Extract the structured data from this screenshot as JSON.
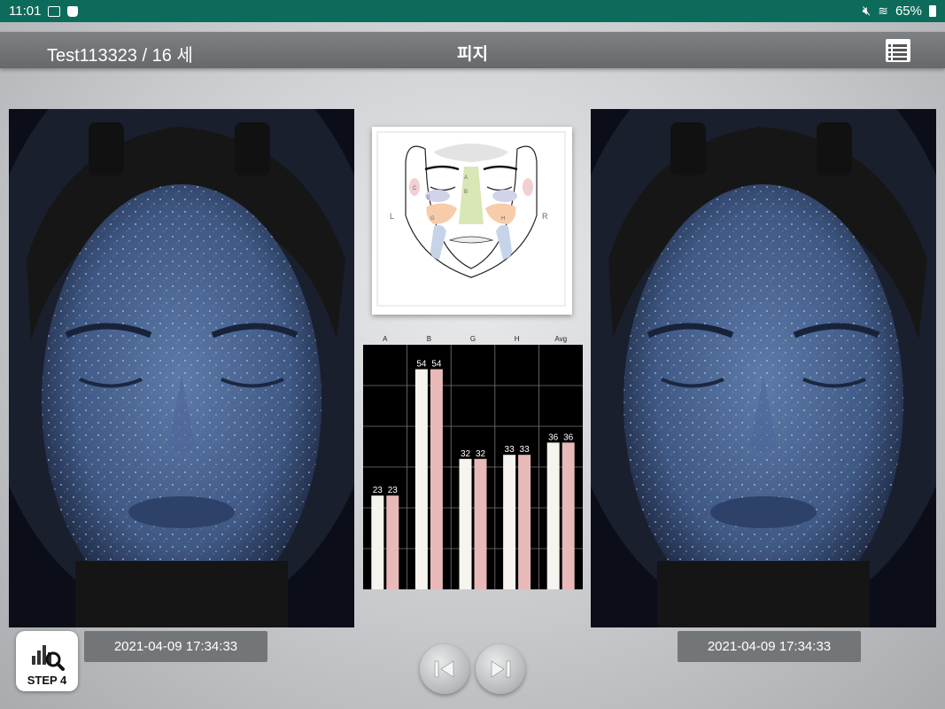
{
  "status_bar": {
    "time": "11:01",
    "battery_text": "65%",
    "icons": [
      "image-icon",
      "bag-icon",
      "mute-icon",
      "wifi-icon",
      "battery-icon"
    ]
  },
  "header": {
    "patient": "Test113323 / 16 세",
    "title": "피지",
    "menu_icon": "list-menu-icon"
  },
  "diagram": {
    "left_label": "L",
    "right_label": "R",
    "zone_labels": [
      "A",
      "B",
      "C",
      "E",
      "G",
      "H"
    ]
  },
  "chart_data": {
    "type": "bar",
    "categories": [
      "A",
      "B",
      "G",
      "H",
      "Avg"
    ],
    "series": [
      {
        "values": [
          23,
          54,
          32,
          33,
          36
        ],
        "color": "#f7f3ee"
      },
      {
        "values": [
          23,
          54,
          32,
          33,
          36
        ],
        "color": "#e8b9b9"
      }
    ],
    "ylim": [
      0,
      60
    ],
    "grid": true,
    "background": "#000000"
  },
  "left_panel": {
    "timestamp": "2021-04-09 17:34:33"
  },
  "right_panel": {
    "timestamp": "2021-04-09 17:34:33"
  },
  "step_button": {
    "label": "STEP 4",
    "icon": "chart-magnifier-icon"
  },
  "nav": {
    "prev_icon": "previous-icon",
    "next_icon": "next-icon"
  }
}
